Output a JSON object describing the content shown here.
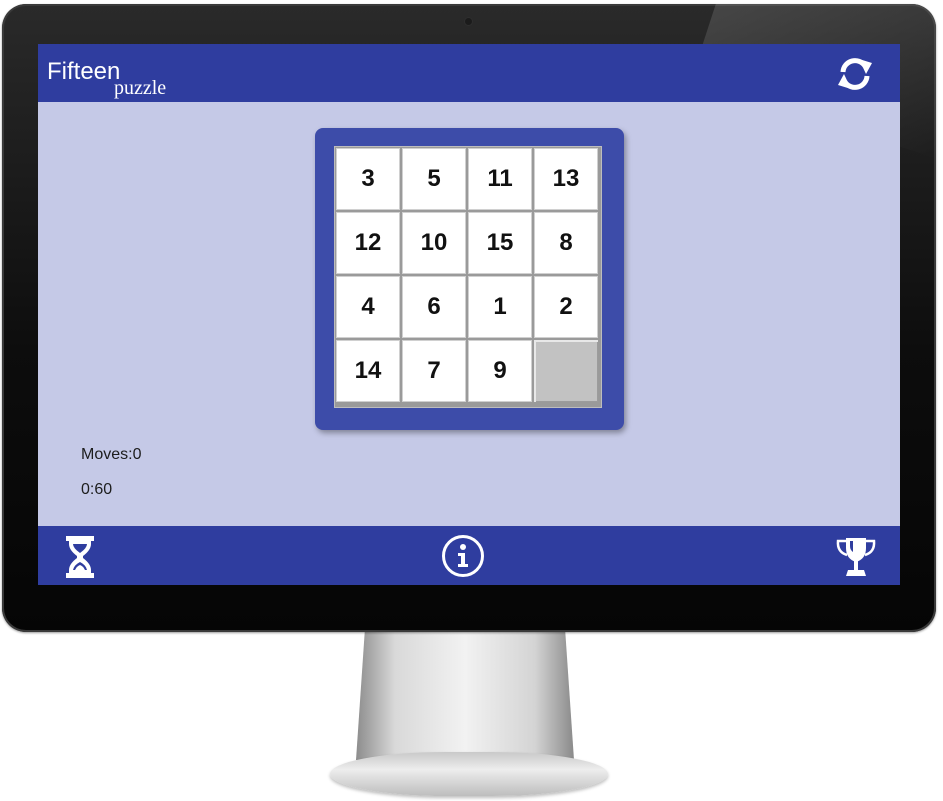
{
  "header": {
    "title_main": "Fifteen",
    "title_sub": "puzzle",
    "refresh_icon": "refresh-icon"
  },
  "board": {
    "tiles": [
      [
        "3",
        "5",
        "11",
        "13"
      ],
      [
        "12",
        "10",
        "15",
        "8"
      ],
      [
        "4",
        "6",
        "1",
        "2"
      ],
      [
        "14",
        "7",
        "9",
        ""
      ]
    ]
  },
  "stats": {
    "moves_text": "Moves:0",
    "timer_text": "0:60"
  },
  "footer": {
    "left_icon": "hourglass-icon",
    "center_icon": "info-icon",
    "right_icon": "trophy-icon"
  },
  "colors": {
    "bar": "#2f3d9f",
    "screen_background": "#c5c9e7",
    "board_frame": "#3d4ca9",
    "tile": "#ffffff",
    "empty_tile": "#c2c2c2"
  }
}
